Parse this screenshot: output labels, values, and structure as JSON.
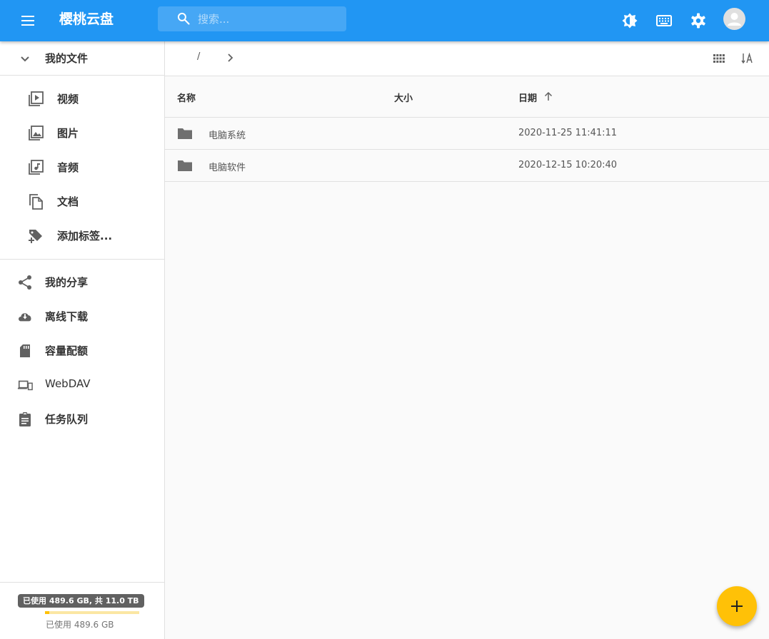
{
  "appbar": {
    "title": "樱桃云盘",
    "search_placeholder": "搜索...",
    "icons": [
      "menu-icon",
      "brightness-icon",
      "keyboard-icon",
      "gear-icon",
      "account-icon"
    ]
  },
  "sidebar": {
    "header": {
      "label": "我的文件",
      "icon": "chevron-down-icon"
    },
    "sub_items": [
      {
        "label": "视频",
        "icon": "video-library-icon"
      },
      {
        "label": "图片",
        "icon": "photo-library-icon"
      },
      {
        "label": "音频",
        "icon": "music-library-icon"
      },
      {
        "label": "文档",
        "icon": "file-copy-icon"
      },
      {
        "label": "添加标签...",
        "icon": "tag-plus-icon"
      }
    ],
    "main_items": [
      {
        "label": "我的分享",
        "icon": "share-icon"
      },
      {
        "label": "离线下载",
        "icon": "cloud-download-icon"
      },
      {
        "label": "容量配额",
        "icon": "sd-card-icon"
      },
      {
        "label": "WebDAV",
        "icon": "devices-icon"
      },
      {
        "label": "任务队列",
        "icon": "clipboard-icon"
      }
    ],
    "storage": {
      "tooltip": "已使用 489.6 GB, 共 11.0 TB",
      "used_text": "已使用 489.6 GB",
      "used_fraction": 0.0435
    }
  },
  "toolbar": {
    "breadcrumb_root": "/",
    "icons": [
      "chevron-right-icon",
      "grid-view-icon",
      "sort-alpha-icon"
    ]
  },
  "table": {
    "columns": {
      "name": "名称",
      "size": "大小",
      "date": "日期"
    },
    "sort_icon": "arrow-up-icon",
    "rows": [
      {
        "name": "电脑系统",
        "size": "",
        "date": "2020-11-25 11:41:11",
        "icon": "folder-icon"
      },
      {
        "name": "电脑软件",
        "size": "",
        "date": "2020-12-15 10:20:40",
        "icon": "folder-icon"
      }
    ]
  },
  "fab": {
    "icon": "plus-icon"
  },
  "colors": {
    "primary": "#2196f3",
    "accent": "#ffc107",
    "icon_gray": "#616161"
  }
}
